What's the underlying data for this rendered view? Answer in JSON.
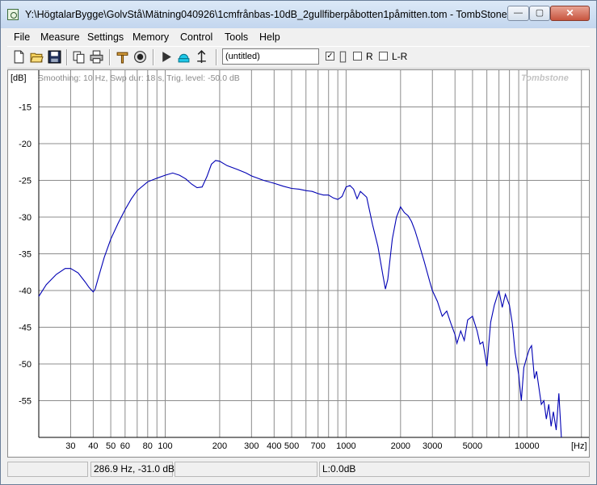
{
  "window": {
    "title": "Y:\\HögtalarBygge\\GolvStå\\Mätning040926\\1cmfrånbas-10dB_2gullfiberpåbotten1påmitten.tom - TombStone",
    "min_glyph": "—",
    "max_glyph": "▢",
    "close_glyph": "✕"
  },
  "menu": [
    "File",
    "Measure",
    "Settings",
    "Memory",
    "Control",
    "Tools",
    "Help"
  ],
  "toolbar": {
    "preset_value": "(untitled)",
    "check1_checked": true,
    "check1_symbol": "✓",
    "r_label": "R",
    "lr_label": "L-R"
  },
  "plot": {
    "info": "Smoothing: 10 Hz, Swp dur: 18 s, Trig. level: -50.0 dB",
    "watermark": "Tombstone",
    "y_unit": "[dB]",
    "x_unit": "[Hz]"
  },
  "status": {
    "cursor": "286.9 Hz, -31.0 dB",
    "level": "L:0.0dB"
  },
  "colors": {
    "trace": "#0000b4",
    "grid": "#8c8c8c"
  },
  "chart_data": {
    "type": "line",
    "title": "",
    "xlabel": "[Hz]",
    "ylabel": "[dB]",
    "x_scale": "log",
    "xlim": [
      20,
      22000
    ],
    "ylim": [
      -60,
      -10
    ],
    "x_ticks": [
      30,
      40,
      50,
      60,
      80,
      100,
      200,
      300,
      400,
      500,
      700,
      1000,
      2000,
      3000,
      5000,
      10000
    ],
    "x_tick_labels": [
      "30",
      "40",
      "50",
      "60",
      "80",
      "100",
      "200",
      "300",
      "400",
      "500",
      "700",
      "1000",
      "2000",
      "3000",
      "5000",
      "10000"
    ],
    "y_ticks": [
      -15,
      -20,
      -25,
      -30,
      -35,
      -40,
      -45,
      -50,
      -55
    ],
    "y_tick_labels": [
      "-15",
      "-20",
      "-25",
      "-30",
      "-35",
      "-40",
      "-45",
      "-50",
      "-55"
    ],
    "grid": true,
    "series": [
      {
        "x": [
          20,
          22,
          25,
          28,
          30,
          33,
          36,
          38,
          40,
          41,
          43,
          46,
          50,
          55,
          60,
          65,
          70,
          80,
          90,
          100,
          110,
          120,
          130,
          140,
          150,
          160,
          170,
          180,
          190,
          200,
          220,
          250,
          280,
          300,
          350,
          400,
          450,
          500,
          550,
          600,
          650,
          700,
          750,
          800,
          850,
          900,
          950,
          1000,
          1050,
          1100,
          1150,
          1200,
          1300,
          1400,
          1500,
          1600,
          1650,
          1700,
          1800,
          1900,
          2000,
          2100,
          2200,
          2300,
          2400,
          2500,
          2700,
          2900,
          3000,
          3200,
          3400,
          3600,
          3800,
          4000,
          4100,
          4300,
          4500,
          4700,
          5000,
          5300,
          5500,
          5700,
          6000,
          6300,
          6600,
          7000,
          7300,
          7600,
          8000,
          8300,
          8600,
          9000,
          9300,
          9600,
          10000,
          10300,
          10600,
          11000,
          11300,
          11600,
          12000,
          12400,
          12800,
          13200,
          13600,
          14000,
          14500,
          15000,
          15500
        ],
        "values": [
          -40.8,
          -39.2,
          -37.8,
          -37.0,
          -37.0,
          -37.6,
          -38.8,
          -39.6,
          -40.2,
          -39.8,
          -38.0,
          -35.5,
          -33.0,
          -30.8,
          -29.0,
          -27.5,
          -26.4,
          -25.2,
          -24.7,
          -24.3,
          -24.0,
          -24.3,
          -24.8,
          -25.5,
          -26.0,
          -25.9,
          -24.5,
          -22.8,
          -22.3,
          -22.4,
          -23.0,
          -23.5,
          -24.0,
          -24.4,
          -25.0,
          -25.4,
          -25.8,
          -26.1,
          -26.2,
          -26.4,
          -26.5,
          -26.8,
          -27.0,
          -27.0,
          -27.4,
          -27.6,
          -27.2,
          -25.9,
          -25.7,
          -26.2,
          -27.5,
          -26.5,
          -27.3,
          -31.0,
          -34.0,
          -38.0,
          -39.8,
          -38.5,
          -33.0,
          -30.0,
          -28.6,
          -29.4,
          -29.8,
          -30.6,
          -31.8,
          -33.2,
          -36.0,
          -38.8,
          -40.0,
          -41.5,
          -43.5,
          -42.8,
          -44.5,
          -46.0,
          -47.2,
          -45.5,
          -46.8,
          -44.0,
          -43.5,
          -45.5,
          -47.3,
          -47.0,
          -50.3,
          -44.3,
          -42.0,
          -40.0,
          -42.3,
          -40.5,
          -42.0,
          -44.5,
          -48.5,
          -51.5,
          -55.0,
          -50.5,
          -49.0,
          -48.0,
          -47.5,
          -52.0,
          -51.0,
          -53.0,
          -55.5,
          -55.0,
          -57.5,
          -55.5,
          -58.5,
          -56.5,
          -59.0,
          -54.0,
          -60.0
        ]
      }
    ]
  }
}
